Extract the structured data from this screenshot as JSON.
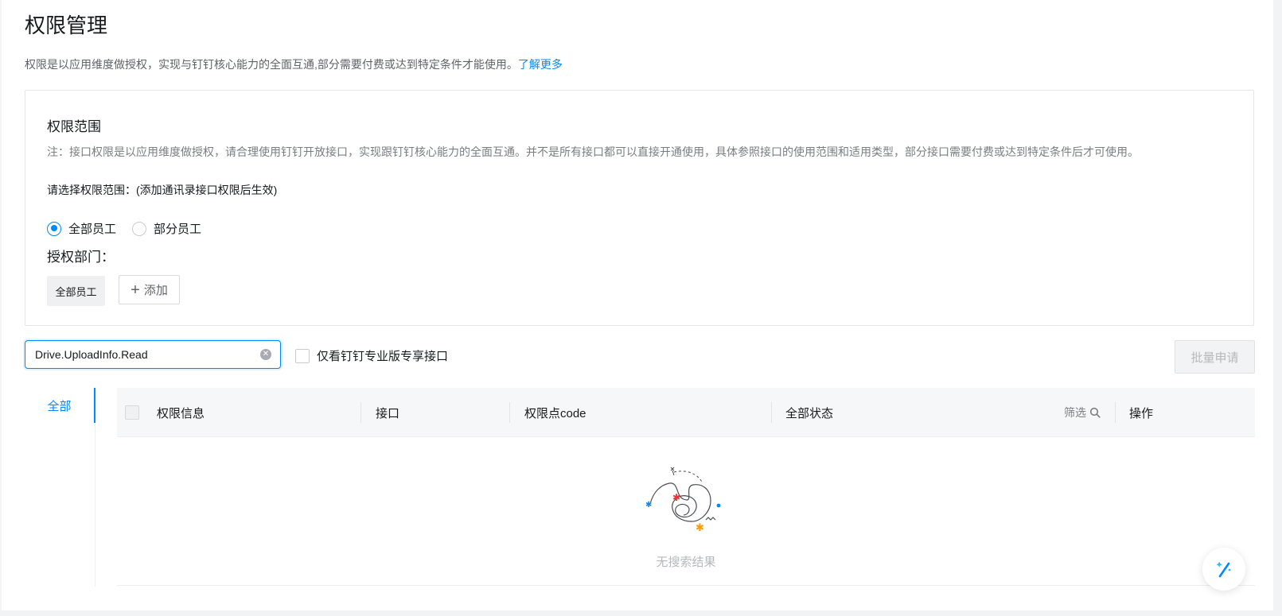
{
  "page": {
    "title": "权限管理",
    "description": "权限是以应用维度做授权，实现与钉钉核心能力的全面互通,部分需要付费或达到特定条件才能使用。",
    "learn_more": "了解更多"
  },
  "scope": {
    "title": "权限范围",
    "note": "注：接口权限是以应用维度做授权，请合理使用钉钉开放接口，实现跟钉钉核心能力的全面互通。并不是所有接口都可以直接开通使用，具体参照接口的使用范围和适用类型，部分接口需要付费或达到特定条件后才可使用。",
    "select_prompt": "请选择权限范围：(添加通讯录接口权限后生效)",
    "radio_all": "全部员工",
    "radio_partial": "部分员工",
    "selected": "全部员工",
    "auth_dept_label": "授权部门：",
    "tag_all": "全部员工",
    "add_label": "添加"
  },
  "toolbar": {
    "search_value": "Drive.UploadInfo.Read",
    "pro_only_label": "仅看钉钉专业版专享接口",
    "pro_only_checked": false,
    "batch_apply": "批量申请"
  },
  "side_tabs": {
    "active": "全部"
  },
  "table": {
    "columns": {
      "info": "权限信息",
      "api": "接口",
      "code": "权限点code",
      "status": "全部状态",
      "filter": "筛选",
      "action": "操作"
    },
    "empty_text": "无搜索结果"
  },
  "colors": {
    "accent": "#0089ff",
    "page_bg": "#f2f3f5"
  },
  "icons": {
    "clear": "clear-circle-icon",
    "search": "search-icon",
    "plus": "plus-icon",
    "assistant": "magic-wand-icon"
  }
}
